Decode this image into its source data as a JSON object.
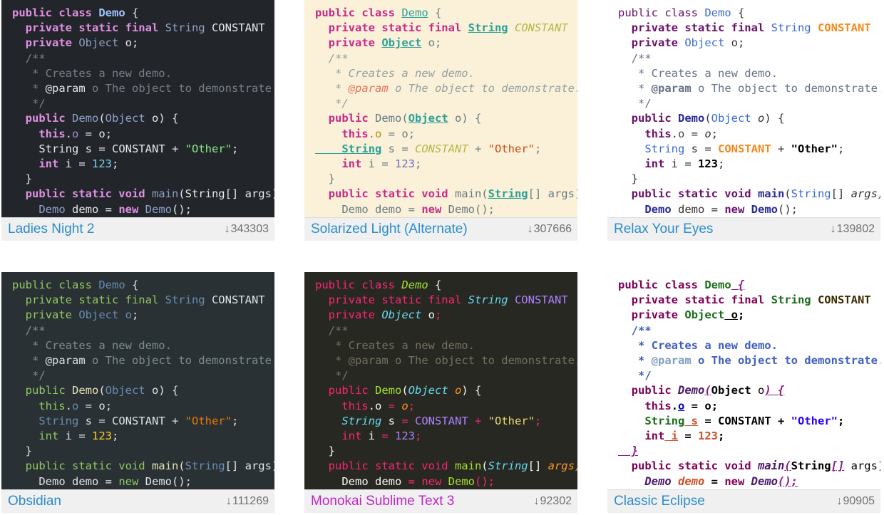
{
  "themes": [
    {
      "name": "Ladies Night 2",
      "downloads": "343303"
    },
    {
      "name": "Solarized Light (Alternate)",
      "downloads": "307666"
    },
    {
      "name": "Relax Your Eyes",
      "downloads": "139802"
    },
    {
      "name": "Obsidian",
      "downloads": "111269"
    },
    {
      "name": "Monokai Sublime Text 3",
      "downloads": "92302"
    },
    {
      "name": "Classic Eclipse",
      "downloads": "90905"
    }
  ],
  "code": {
    "l1_kw": "public class ",
    "l1_cls": "Demo",
    "l1_end": " {",
    "l2_kw": "  private static final ",
    "l2_type": "String",
    "l2_const": " CONSTANT",
    "l3_kw": "  private ",
    "l3_type": "Object",
    "l3_field": " o",
    "l3_end": ";",
    "l4": "  /**",
    "l5": "   * Creates a new demo.",
    "l6_pre": "   * ",
    "l6_tag": "@param",
    "l6_rest": " o The object to demonstrate.",
    "l7": "   */",
    "l8_kw": "  public ",
    "l8_name": "Demo",
    "l8_open": "(",
    "l8_type": "Object",
    "l8_param": " o",
    "l8_end": ") {",
    "l9_kw": "    this",
    "l9_dot": ".",
    "l9_field": "o",
    "l9_eq": " = ",
    "l9_val": "o",
    "l9_end": ";",
    "l10_type": "    String",
    "l10_var": " s",
    "l10_eq": " = ",
    "l10_const": "CONSTANT",
    "l10_plus": " + ",
    "l10_str": "\"Other\"",
    "l10_end": ";",
    "l11_kw": "    int",
    "l11_var": " i",
    "l11_eq": " = ",
    "l11_num": "123",
    "l11_end": ";",
    "l12": "  }",
    "l13_kw": "  public static void ",
    "l13_name": "main",
    "l13_open": "(",
    "l13_type": "String",
    "l13_arr": "[]",
    "l13_rest": " args) {",
    "l14_type": "    Demo",
    "l14_var": " demo",
    "l14_eq": " = ",
    "l14_new": "new ",
    "l14_cls": "Demo",
    "l14_end": "();"
  }
}
